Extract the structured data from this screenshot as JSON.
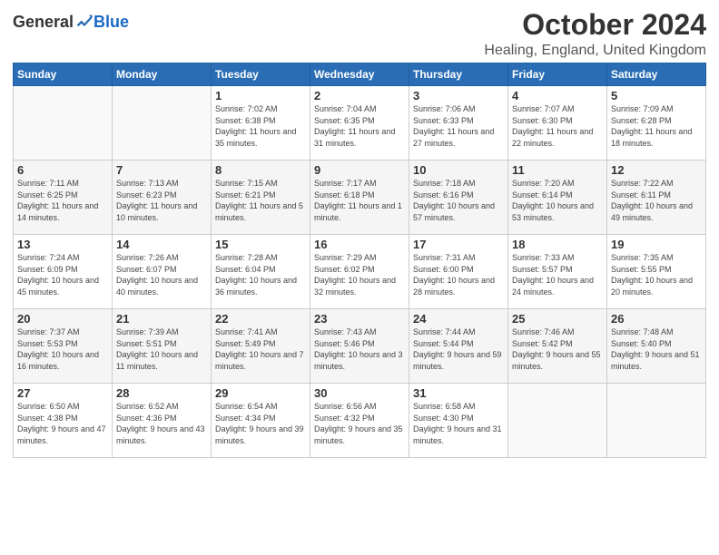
{
  "logo": {
    "general": "General",
    "blue": "Blue"
  },
  "title": "October 2024",
  "location": "Healing, England, United Kingdom",
  "days_of_week": [
    "Sunday",
    "Monday",
    "Tuesday",
    "Wednesday",
    "Thursday",
    "Friday",
    "Saturday"
  ],
  "weeks": [
    [
      {
        "day": "",
        "info": ""
      },
      {
        "day": "",
        "info": ""
      },
      {
        "day": "1",
        "info": "Sunrise: 7:02 AM\nSunset: 6:38 PM\nDaylight: 11 hours and 35 minutes."
      },
      {
        "day": "2",
        "info": "Sunrise: 7:04 AM\nSunset: 6:35 PM\nDaylight: 11 hours and 31 minutes."
      },
      {
        "day": "3",
        "info": "Sunrise: 7:06 AM\nSunset: 6:33 PM\nDaylight: 11 hours and 27 minutes."
      },
      {
        "day": "4",
        "info": "Sunrise: 7:07 AM\nSunset: 6:30 PM\nDaylight: 11 hours and 22 minutes."
      },
      {
        "day": "5",
        "info": "Sunrise: 7:09 AM\nSunset: 6:28 PM\nDaylight: 11 hours and 18 minutes."
      }
    ],
    [
      {
        "day": "6",
        "info": "Sunrise: 7:11 AM\nSunset: 6:25 PM\nDaylight: 11 hours and 14 minutes."
      },
      {
        "day": "7",
        "info": "Sunrise: 7:13 AM\nSunset: 6:23 PM\nDaylight: 11 hours and 10 minutes."
      },
      {
        "day": "8",
        "info": "Sunrise: 7:15 AM\nSunset: 6:21 PM\nDaylight: 11 hours and 5 minutes."
      },
      {
        "day": "9",
        "info": "Sunrise: 7:17 AM\nSunset: 6:18 PM\nDaylight: 11 hours and 1 minute."
      },
      {
        "day": "10",
        "info": "Sunrise: 7:18 AM\nSunset: 6:16 PM\nDaylight: 10 hours and 57 minutes."
      },
      {
        "day": "11",
        "info": "Sunrise: 7:20 AM\nSunset: 6:14 PM\nDaylight: 10 hours and 53 minutes."
      },
      {
        "day": "12",
        "info": "Sunrise: 7:22 AM\nSunset: 6:11 PM\nDaylight: 10 hours and 49 minutes."
      }
    ],
    [
      {
        "day": "13",
        "info": "Sunrise: 7:24 AM\nSunset: 6:09 PM\nDaylight: 10 hours and 45 minutes."
      },
      {
        "day": "14",
        "info": "Sunrise: 7:26 AM\nSunset: 6:07 PM\nDaylight: 10 hours and 40 minutes."
      },
      {
        "day": "15",
        "info": "Sunrise: 7:28 AM\nSunset: 6:04 PM\nDaylight: 10 hours and 36 minutes."
      },
      {
        "day": "16",
        "info": "Sunrise: 7:29 AM\nSunset: 6:02 PM\nDaylight: 10 hours and 32 minutes."
      },
      {
        "day": "17",
        "info": "Sunrise: 7:31 AM\nSunset: 6:00 PM\nDaylight: 10 hours and 28 minutes."
      },
      {
        "day": "18",
        "info": "Sunrise: 7:33 AM\nSunset: 5:57 PM\nDaylight: 10 hours and 24 minutes."
      },
      {
        "day": "19",
        "info": "Sunrise: 7:35 AM\nSunset: 5:55 PM\nDaylight: 10 hours and 20 minutes."
      }
    ],
    [
      {
        "day": "20",
        "info": "Sunrise: 7:37 AM\nSunset: 5:53 PM\nDaylight: 10 hours and 16 minutes."
      },
      {
        "day": "21",
        "info": "Sunrise: 7:39 AM\nSunset: 5:51 PM\nDaylight: 10 hours and 11 minutes."
      },
      {
        "day": "22",
        "info": "Sunrise: 7:41 AM\nSunset: 5:49 PM\nDaylight: 10 hours and 7 minutes."
      },
      {
        "day": "23",
        "info": "Sunrise: 7:43 AM\nSunset: 5:46 PM\nDaylight: 10 hours and 3 minutes."
      },
      {
        "day": "24",
        "info": "Sunrise: 7:44 AM\nSunset: 5:44 PM\nDaylight: 9 hours and 59 minutes."
      },
      {
        "day": "25",
        "info": "Sunrise: 7:46 AM\nSunset: 5:42 PM\nDaylight: 9 hours and 55 minutes."
      },
      {
        "day": "26",
        "info": "Sunrise: 7:48 AM\nSunset: 5:40 PM\nDaylight: 9 hours and 51 minutes."
      }
    ],
    [
      {
        "day": "27",
        "info": "Sunrise: 6:50 AM\nSunset: 4:38 PM\nDaylight: 9 hours and 47 minutes."
      },
      {
        "day": "28",
        "info": "Sunrise: 6:52 AM\nSunset: 4:36 PM\nDaylight: 9 hours and 43 minutes."
      },
      {
        "day": "29",
        "info": "Sunrise: 6:54 AM\nSunset: 4:34 PM\nDaylight: 9 hours and 39 minutes."
      },
      {
        "day": "30",
        "info": "Sunrise: 6:56 AM\nSunset: 4:32 PM\nDaylight: 9 hours and 35 minutes."
      },
      {
        "day": "31",
        "info": "Sunrise: 6:58 AM\nSunset: 4:30 PM\nDaylight: 9 hours and 31 minutes."
      },
      {
        "day": "",
        "info": ""
      },
      {
        "day": "",
        "info": ""
      }
    ]
  ]
}
